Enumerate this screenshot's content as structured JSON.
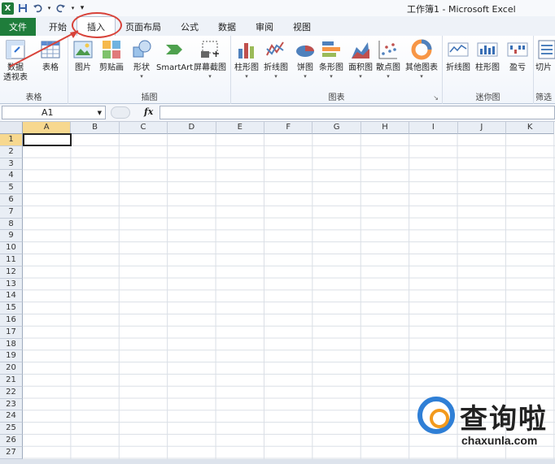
{
  "window": {
    "title": "工作簿1 - Microsoft Excel"
  },
  "tabs": [
    {
      "label": "文件"
    },
    {
      "label": "开始"
    },
    {
      "label": "插入"
    },
    {
      "label": "页面布局"
    },
    {
      "label": "公式"
    },
    {
      "label": "数据"
    },
    {
      "label": "审阅"
    },
    {
      "label": "视图"
    }
  ],
  "ribbon": {
    "groups": {
      "tables": "表格",
      "illustrations": "插图",
      "charts": "图表",
      "sparklines": "迷你图",
      "filter": "筛选"
    },
    "buttons": {
      "pivot_line1": "数据",
      "pivot_line2": "透视表",
      "table": "表格",
      "picture": "图片",
      "clipart": "剪贴画",
      "shapes": "形状",
      "smartart": "SmartArt",
      "screenshot": "屏幕截图",
      "column": "柱形图",
      "line": "折线图",
      "pie": "饼图",
      "bar": "条形图",
      "area": "面积图",
      "scatter": "散点图",
      "other": "其他图表",
      "spark_line": "折线图",
      "spark_column": "柱形图",
      "spark_winloss": "盈亏",
      "slicer": "切片"
    }
  },
  "formula_bar": {
    "name_box": "A1",
    "fx": "fx",
    "value": ""
  },
  "grid": {
    "columns": [
      "A",
      "B",
      "C",
      "D",
      "E",
      "F",
      "G",
      "H",
      "I",
      "J",
      "K"
    ],
    "rows": [
      "1",
      "2",
      "3",
      "4",
      "5",
      "6",
      "7",
      "8",
      "9",
      "10",
      "11",
      "12",
      "13",
      "14",
      "15",
      "16",
      "17",
      "18",
      "19",
      "20",
      "21",
      "22",
      "23",
      "24",
      "25",
      "26",
      "27"
    ],
    "active_cell": "A1"
  },
  "watermark": {
    "brand": "查询啦",
    "url": "chaxunla.com"
  },
  "colors": {
    "file_tab": "#1f7d3b",
    "annotation": "#d8433a",
    "header_selected": "#f7d88f"
  }
}
